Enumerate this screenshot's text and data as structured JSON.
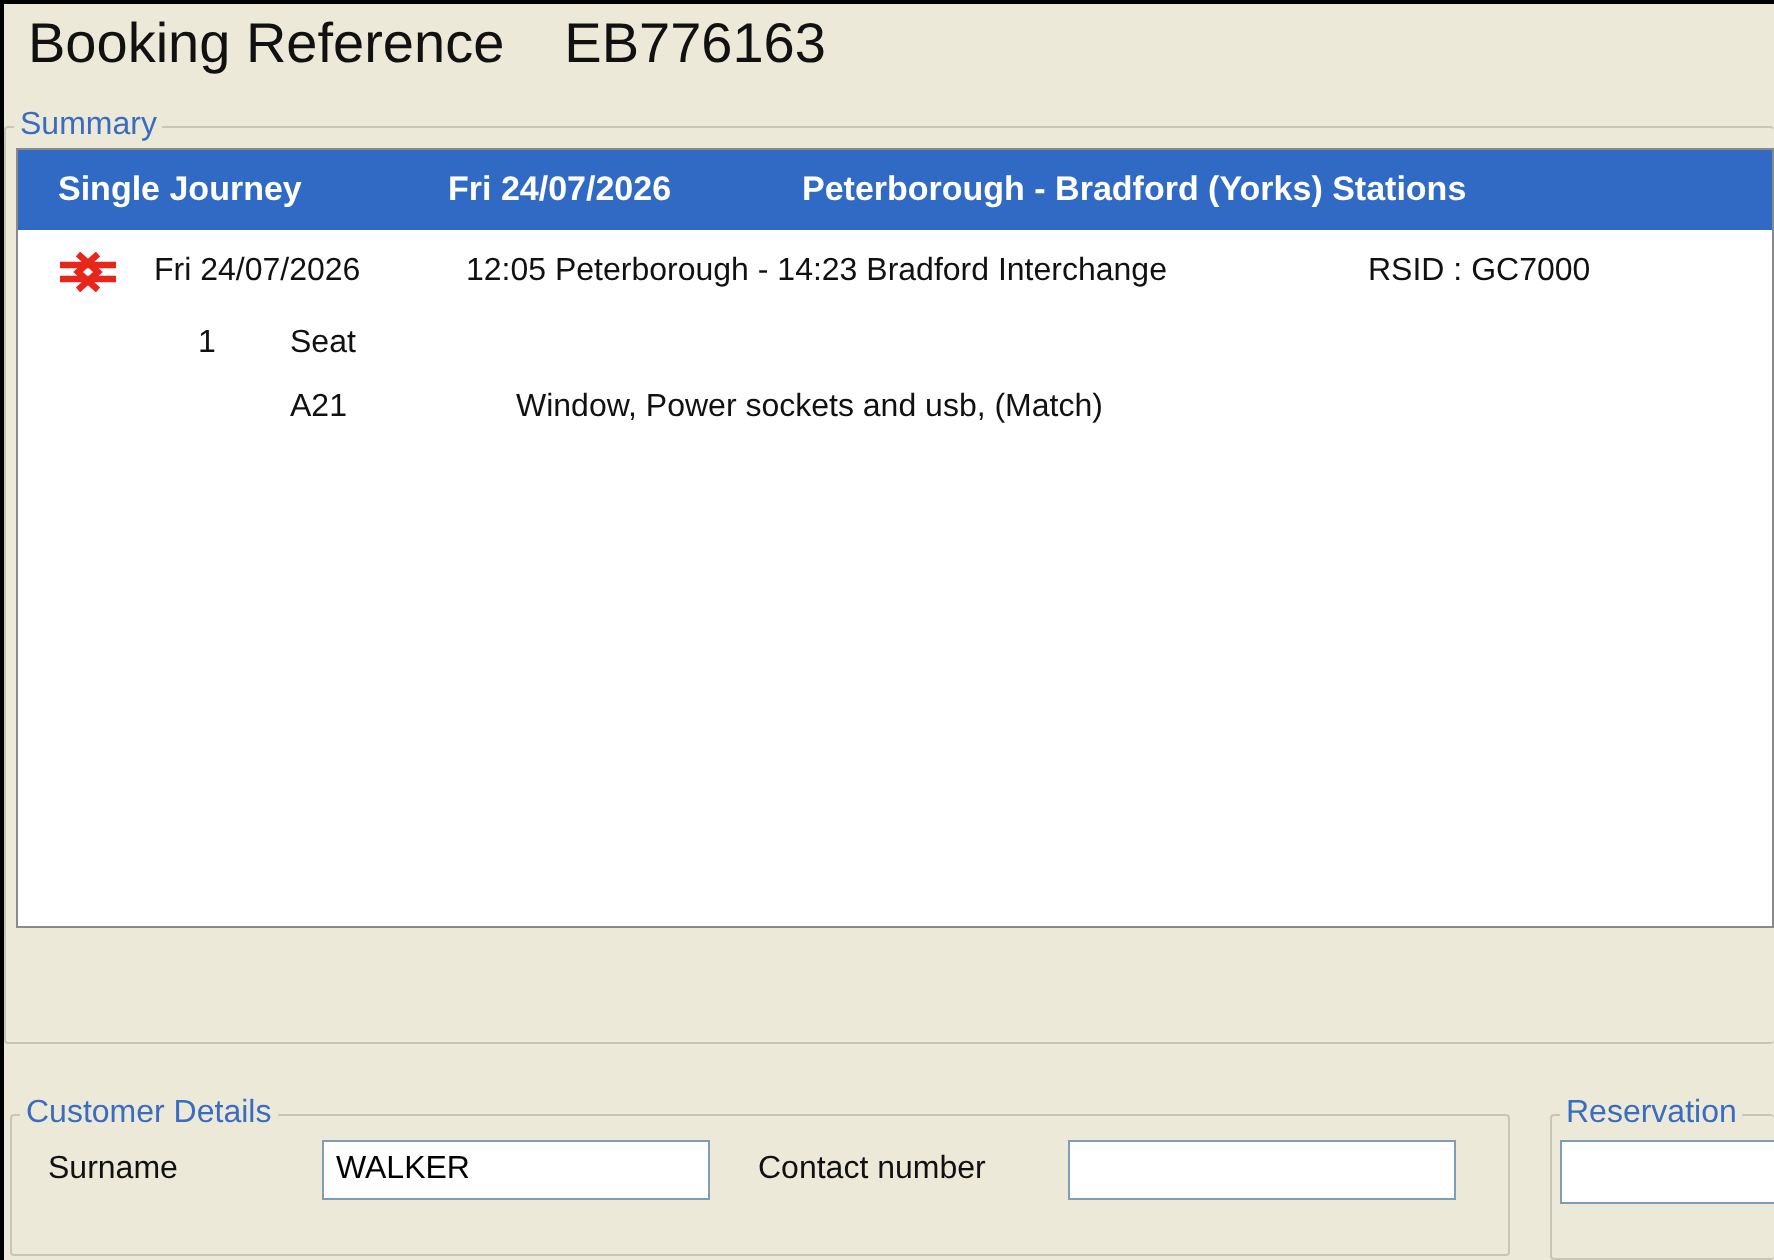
{
  "title": {
    "label": "Booking Reference",
    "reference": "EB776163"
  },
  "summary": {
    "legend": "Summary",
    "header": [
      "Single Journey",
      "Fri 24/07/2026",
      "Peterborough - Bradford (Yorks) Stations"
    ],
    "journeys": [
      {
        "date": "Fri 24/07/2026",
        "service": "12:05 Peterborough - 14:23 Bradford Interchange",
        "rsid": "RSID : GC7000",
        "seat_count": "1",
        "seat_label": "Seat",
        "seats": [
          {
            "number": "A21",
            "attributes": "Window, Power sockets and usb, (Match)"
          }
        ]
      }
    ]
  },
  "customer_details": {
    "legend": "Customer Details",
    "fields": [
      {
        "label": "Surname",
        "value": "WALKER"
      },
      {
        "label": "Contact number"
      }
    ]
  },
  "reservation": {
    "legend": "Reservation"
  }
}
